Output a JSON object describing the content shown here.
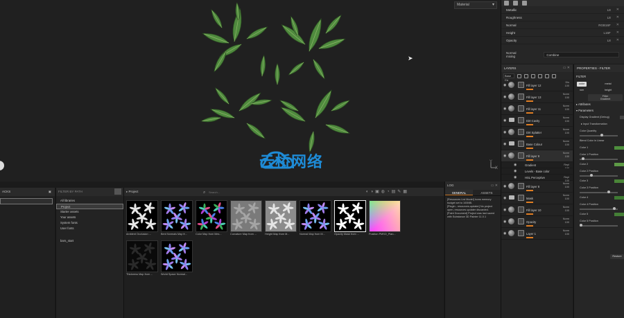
{
  "viewport": {
    "display_select": "Material",
    "axis_y": "Y",
    "axis_x": "X",
    "watermark": "云桥网络"
  },
  "texture_set": {
    "channels": [
      {
        "name": "Metallic",
        "format": "L8"
      },
      {
        "name": "Roughness",
        "format": "L8"
      },
      {
        "name": "Normal",
        "format": "RGB16F"
      },
      {
        "name": "Height",
        "format": "L16F"
      },
      {
        "name": "Opacity",
        "format": "L8"
      }
    ],
    "normal_mixing_label": "Normal mixing",
    "normal_mixing_value": "Combine"
  },
  "layers": {
    "title": "LAYERS",
    "dropdown": "Base Co",
    "items": [
      {
        "name": "Fill layer 12",
        "blend": "Dis",
        "opacity": "100",
        "type": "fill",
        "sel": false
      },
      {
        "name": "Fill layer 13",
        "blend": "Norm",
        "opacity": "100",
        "type": "fill",
        "sel": false
      },
      {
        "name": "Fill layer 11",
        "blend": "Norm",
        "opacity": "100",
        "type": "fill",
        "sel": false
      },
      {
        "name": "Dirt Cavity",
        "blend": "Norm",
        "opacity": "100",
        "type": "folder",
        "sel": false
      },
      {
        "name": "Dirt Splatter",
        "blend": "Norm",
        "opacity": "100",
        "type": "fill",
        "sel": false
      },
      {
        "name": "Base Colour",
        "blend": "Norm",
        "opacity": "100",
        "type": "folder",
        "sel": false
      },
      {
        "name": "Fill layer 9",
        "blend": "Norm",
        "opacity": "100",
        "type": "fill",
        "sel": true
      },
      {
        "name": "Gradient",
        "blend": "Repl",
        "opacity": "100",
        "type": "sub",
        "sel": true
      },
      {
        "name": "Levels - Base color",
        "blend": "",
        "opacity": "",
        "type": "sub",
        "sel": false
      },
      {
        "name": "HSL Perceptive",
        "blend": "Repl",
        "opacity": "100",
        "type": "sub",
        "sel": false
      },
      {
        "name": "Fill layer 8",
        "blend": "Norm",
        "opacity": "100",
        "type": "fill",
        "sel": false
      },
      {
        "name": "Mask",
        "blend": "Norm",
        "opacity": "100",
        "type": "folder",
        "sel": false
      },
      {
        "name": "Fill layer 10",
        "blend": "Norm",
        "opacity": "100",
        "type": "fill",
        "sel": false
      },
      {
        "name": "Opacity",
        "blend": "Norm",
        "opacity": "100",
        "type": "fill",
        "sel": false
      },
      {
        "name": "Layer 1",
        "blend": "Norm",
        "opacity": "100",
        "type": "paint",
        "sel": false
      }
    ]
  },
  "properties": {
    "title": "PROPERTIES - FILTER",
    "filter_label": "FILTER",
    "pills": [
      "color",
      "metal",
      "rom",
      "height"
    ],
    "filter_name": "Filter",
    "filter_sub": "Gradient",
    "attributes": "Attributes",
    "parameters": "Parameters",
    "display_gradient": "Display Gradient (Debug)",
    "input_transformation": "Input Transformation",
    "color_quantity": "Color Quantity",
    "blend_linear": "Blend Color in Linear",
    "colors": [
      {
        "label": "Color 1",
        "pos": "Color 1 Position",
        "swatch": "#4e8f3d",
        "knob": 0.05
      },
      {
        "label": "Color 2",
        "pos": "Color 2 Position",
        "swatch": "#5d9a46",
        "knob": 0.3
      },
      {
        "label": "Color 3",
        "pos": "Color 3 Position",
        "swatch": "#4a8538",
        "knob": 0.78
      },
      {
        "label": "Color 4",
        "pos": "Color 4 Position",
        "swatch": "#3f7a33",
        "knob": 0.95
      },
      {
        "label": "Color 5",
        "pos": "Color 5 Position",
        "swatch": "#447f36",
        "knob": 0
      }
    ],
    "restore": "Restore"
  },
  "shelf": {
    "left_header": "ACKS",
    "tree_header": "FILTER BY PATH",
    "tree": [
      "All libraries",
      "Project",
      "Starter assets",
      "Your assets",
      "System fonts",
      "User fonts",
      "bars_start"
    ],
    "tree_selected": 1,
    "breadcrumb": "Project",
    "search_placeholder": "Search...",
    "assets": [
      {
        "caption": "Ambient Occlusion ...",
        "style": "bw",
        "sel": false
      },
      {
        "caption": "Bent Normals Map fr...",
        "style": "normal",
        "sel": false
      },
      {
        "caption": "Color Map from Mes...",
        "style": "color",
        "sel": false
      },
      {
        "caption": "Curvature Map from ...",
        "style": "curv",
        "sel": false
      },
      {
        "caption": "Height Map from M...",
        "style": "height",
        "sel": false
      },
      {
        "caption": "Normal Map from M...",
        "style": "normal",
        "sel": false
      },
      {
        "caption": "Opacity Mask from ...",
        "style": "mask",
        "sel": true
      },
      {
        "caption": "Position PMSO_Plan...",
        "style": "position",
        "sel": false
      },
      {
        "caption": "Thickness Map from ...",
        "style": "thick",
        "sel": false
      },
      {
        "caption": "World Space Normal...",
        "style": "normal",
        "sel": false
      }
    ]
  },
  "log": {
    "title": "LOG",
    "tabs": [
      "GENERAL",
      "ASSETS"
    ],
    "lines": [
      "[Resources List Model] Icons memory budget set to 100MB.",
      "[Plugin - resources-updater] No project open, resources updater discarded.",
      "[Paint Document] Project was last saved with Substance 3D Painter 11.0.1"
    ]
  }
}
